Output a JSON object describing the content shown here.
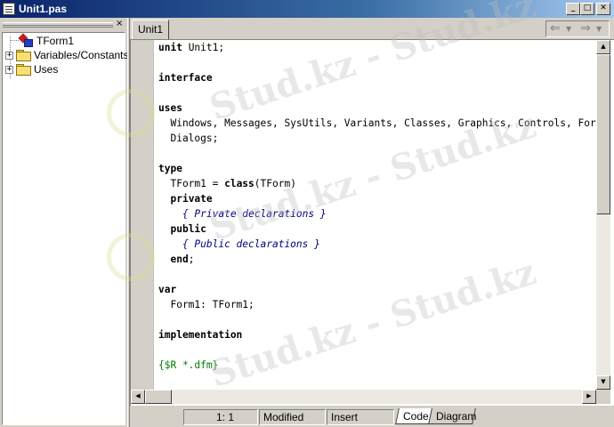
{
  "window": {
    "title": "Unit1.pas",
    "buttons": {
      "minimize": "_",
      "maximize": "□",
      "close": "✕"
    }
  },
  "explorer": {
    "close_glyph": "×",
    "items": [
      {
        "label": "TForm1",
        "icon": "form-class-icon",
        "expandable": false
      },
      {
        "label": "Variables/Constants",
        "icon": "folder-icon",
        "expandable": true,
        "expander": "+"
      },
      {
        "label": "Uses",
        "icon": "folder-icon",
        "expandable": true,
        "expander": "+"
      }
    ]
  },
  "editor": {
    "tabs": [
      {
        "label": "Unit1",
        "active": true
      }
    ],
    "nav": {
      "back": "⇐",
      "back_dropdown": "▼",
      "forward": "⇒",
      "forward_dropdown": "▼"
    },
    "code_lines": [
      [
        {
          "t": "unit",
          "k": "kw"
        },
        {
          "t": " Unit1;",
          "k": ""
        }
      ],
      [],
      [
        {
          "t": "interface",
          "k": "kw"
        }
      ],
      [],
      [
        {
          "t": "uses",
          "k": "kw"
        }
      ],
      [
        {
          "t": "  Windows, Messages, SysUtils, Variants, Classes, Graphics, Controls, Forms,",
          "k": ""
        }
      ],
      [
        {
          "t": "  Dialogs;",
          "k": ""
        }
      ],
      [],
      [
        {
          "t": "type",
          "k": "kw"
        }
      ],
      [
        {
          "t": "  TForm1 = ",
          "k": ""
        },
        {
          "t": "class",
          "k": "kw"
        },
        {
          "t": "(TForm)",
          "k": ""
        }
      ],
      [
        {
          "t": "  ",
          "k": ""
        },
        {
          "t": "private",
          "k": "kw"
        }
      ],
      [
        {
          "t": "    { Private declarations }",
          "k": "cmt"
        }
      ],
      [
        {
          "t": "  ",
          "k": ""
        },
        {
          "t": "public",
          "k": "kw"
        }
      ],
      [
        {
          "t": "    { Public declarations }",
          "k": "cmt"
        }
      ],
      [
        {
          "t": "  ",
          "k": ""
        },
        {
          "t": "end",
          "k": "kw"
        },
        {
          "t": ";",
          "k": ""
        }
      ],
      [],
      [
        {
          "t": "var",
          "k": "kw"
        }
      ],
      [
        {
          "t": "  Form1: TForm1;",
          "k": ""
        }
      ],
      [],
      [
        {
          "t": "implementation",
          "k": "kw"
        }
      ],
      [],
      [
        {
          "t": "{$R *.dfm}",
          "k": "dir"
        }
      ]
    ]
  },
  "scrollbars": {
    "up": "▲",
    "down": "▼",
    "left": "◀",
    "right": "▶"
  },
  "statusbar": {
    "position": "1:  1",
    "modified": "Modified",
    "mode": "Insert",
    "view_tabs": [
      {
        "label": "Code",
        "active": true
      },
      {
        "label": "Diagram",
        "active": false
      }
    ]
  },
  "watermark": {
    "text": "Stud.kz - Stud.kz"
  }
}
